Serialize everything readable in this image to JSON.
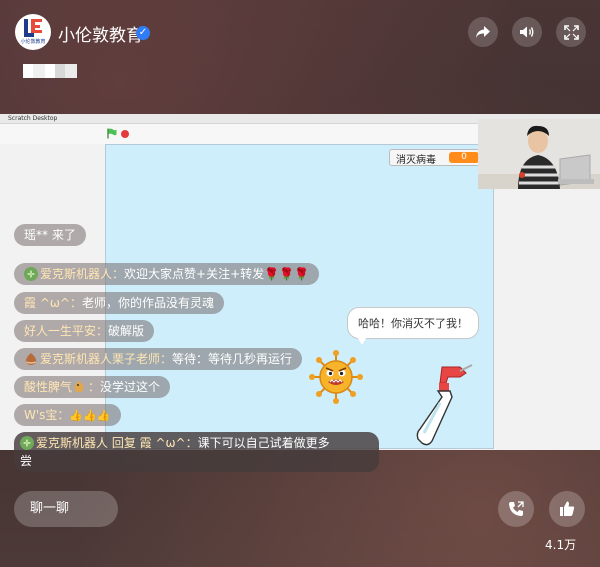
{
  "header": {
    "logo_caption": "小伦敦教育",
    "title": "小伦敦教育",
    "verified_icon": "check-badge-icon",
    "buttons": [
      "share-icon",
      "volume-icon",
      "fullscreen-icon"
    ]
  },
  "screen_share": {
    "window_title": "Scratch Desktop",
    "variable_label": "消灭病毒",
    "variable_value": "0",
    "speech_bubble": "哈哈！你消灭不了我！"
  },
  "chat": {
    "messages": [
      {
        "text": "瑶** 来了"
      },
      {
        "name": "爱克斯机器人：",
        "text": "欢迎大家点赞+关注+转发🌹🌹🌹"
      },
      {
        "name": "霞 ^ω^：",
        "text": "老师，你的作品没有灵魂"
      },
      {
        "name": "好人一生平安：",
        "text": "破解版"
      },
      {
        "name": "爱克斯机器人栗子老师：",
        "text": "等待：等待几秒再运行"
      },
      {
        "name": "酸性脾气",
        "name_suffix": "：",
        "text": "没学过这个"
      },
      {
        "name": "W's宝：",
        "text": "👍👍👍"
      },
      {
        "name": "爱克斯机器人 回复 霞 ^ω^：",
        "text": "课下可以自己试着做更多",
        "text2": "尝"
      }
    ]
  },
  "bottom": {
    "chat_placeholder": "聊一聊",
    "like_count": "4.1万"
  },
  "colors": {
    "accent_blue": "#2f7cf6",
    "variable_orange": "#ff8c1a",
    "stage_bg": "#cdeefa"
  }
}
